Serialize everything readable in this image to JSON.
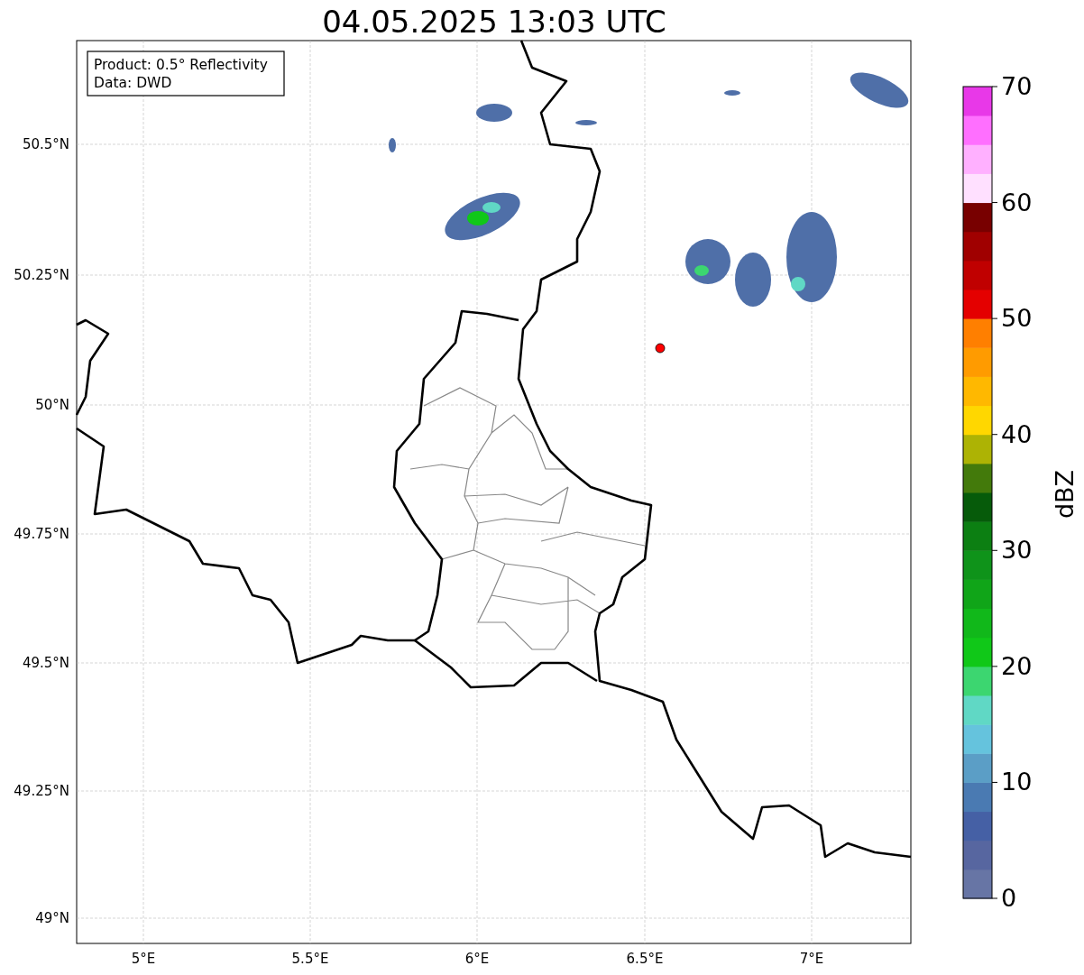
{
  "title": "04.05.2025 13:03 UTC",
  "info_box": {
    "lines": [
      "Product: 0.5° Reflectivity",
      "Data: DWD"
    ]
  },
  "map": {
    "lat_labels": [
      "50.5°N",
      "50.25°N",
      "50°N",
      "49.75°N",
      "49.5°N",
      "49.25°N",
      "49°N"
    ],
    "lon_labels": [
      "5°E",
      "5.5°E",
      "6°E",
      "6.5°E",
      "7°E"
    ]
  },
  "colorbar": {
    "label": "dBZ",
    "ticks": [
      "70",
      "60",
      "50",
      "40",
      "30",
      "20",
      "10",
      "0"
    ],
    "segments": [
      {
        "color": "#6775a5"
      },
      {
        "color": "#5766a0"
      },
      {
        "color": "#4560a5"
      },
      {
        "color": "#4a7ab2"
      },
      {
        "color": "#5b9ec6"
      },
      {
        "color": "#65c3dd"
      },
      {
        "color": "#60d8c5"
      },
      {
        "color": "#3cd670"
      },
      {
        "color": "#10c818"
      },
      {
        "color": "#11b81a"
      },
      {
        "color": "#10a518"
      },
      {
        "color": "#0f931a"
      },
      {
        "color": "#0c7f12"
      },
      {
        "color": "#065b0a"
      },
      {
        "color": "#437a0b"
      },
      {
        "color": "#adb304"
      },
      {
        "color": "#ffd700"
      },
      {
        "color": "#ffb800"
      },
      {
        "color": "#ff9b00"
      },
      {
        "color": "#ff7f00"
      },
      {
        "color": "#e40000"
      },
      {
        "color": "#c00000"
      },
      {
        "color": "#a00000"
      },
      {
        "color": "#780000"
      },
      {
        "color": "#ffe0ff"
      },
      {
        "color": "#ffb0ff"
      },
      {
        "color": "#ff6fff"
      },
      {
        "color": "#e838e8"
      }
    ]
  }
}
